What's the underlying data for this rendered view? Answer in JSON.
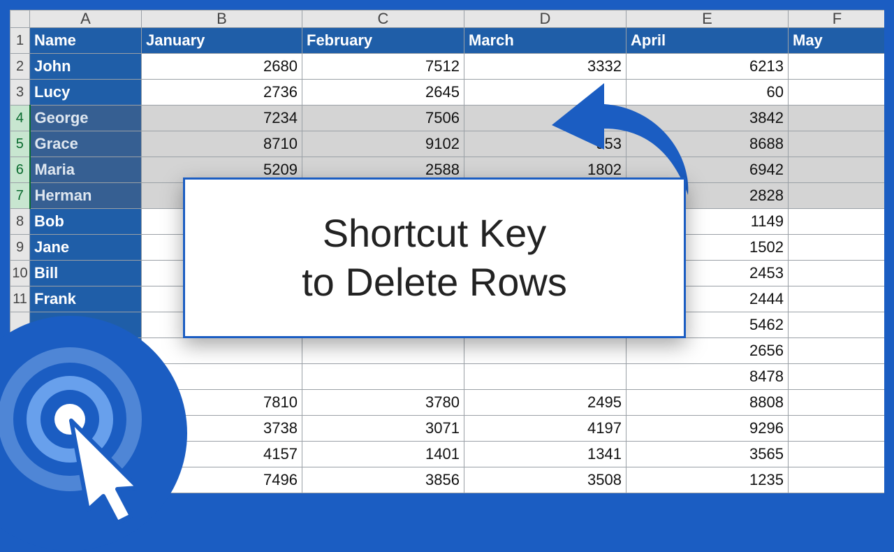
{
  "columns": [
    "A",
    "B",
    "C",
    "D",
    "E",
    "F"
  ],
  "header": {
    "name": "Name",
    "months": [
      "January",
      "February",
      "March",
      "April",
      "May"
    ]
  },
  "rows": [
    {
      "n": "2",
      "name": "John",
      "v": [
        "2680",
        "7512",
        "3332",
        "6213",
        ""
      ]
    },
    {
      "n": "3",
      "name": "Lucy",
      "v": [
        "2736",
        "2645",
        "",
        "60",
        ""
      ]
    },
    {
      "n": "4",
      "name": "George",
      "v": [
        "7234",
        "7506",
        "",
        "3842",
        ""
      ],
      "sel": true
    },
    {
      "n": "5",
      "name": "Grace",
      "v": [
        "8710",
        "9102",
        "953",
        "8688",
        ""
      ],
      "sel": true
    },
    {
      "n": "6",
      "name": "Maria",
      "v": [
        "5209",
        "2588",
        "1802",
        "6942",
        ""
      ],
      "sel": true
    },
    {
      "n": "7",
      "name": "Herman",
      "v": [
        "",
        "",
        "",
        "2828",
        ""
      ],
      "sel": true
    },
    {
      "n": "8",
      "name": "Bob",
      "v": [
        "",
        "",
        "",
        "1149",
        ""
      ]
    },
    {
      "n": "9",
      "name": "Jane",
      "v": [
        "",
        "",
        "",
        "1502",
        ""
      ]
    },
    {
      "n": "10",
      "name": "Bill",
      "v": [
        "",
        "",
        "",
        "2453",
        ""
      ]
    },
    {
      "n": "11",
      "name": "Frank",
      "v": [
        "",
        "",
        "",
        "2444",
        ""
      ]
    },
    {
      "n": "",
      "name": "",
      "v": [
        "",
        "",
        "",
        "5462",
        ""
      ]
    },
    {
      "n": "",
      "name": "",
      "v": [
        "",
        "",
        "",
        "2656",
        ""
      ]
    },
    {
      "n": "",
      "name": "",
      "v": [
        "",
        "",
        "",
        "8478",
        ""
      ]
    },
    {
      "n": "",
      "name": "",
      "v": [
        "7810",
        "3780",
        "2495",
        "8808",
        ""
      ]
    },
    {
      "n": "",
      "name": "",
      "v": [
        "3738",
        "3071",
        "4197",
        "9296",
        ""
      ]
    },
    {
      "n": "",
      "name": "",
      "v": [
        "4157",
        "1401",
        "1341",
        "3565",
        ""
      ]
    },
    {
      "n": "",
      "name": "",
      "v": [
        "7496",
        "3856",
        "3508",
        "1235",
        ""
      ]
    }
  ],
  "overlay": {
    "line1": "Shortcut Key",
    "line2": "to Delete Rows"
  },
  "colors": {
    "brand": "#1b5dc2",
    "header_bg": "#1f5ea8",
    "sel_row": "#d4d4d4",
    "sel_head": "#c8e6d0"
  }
}
